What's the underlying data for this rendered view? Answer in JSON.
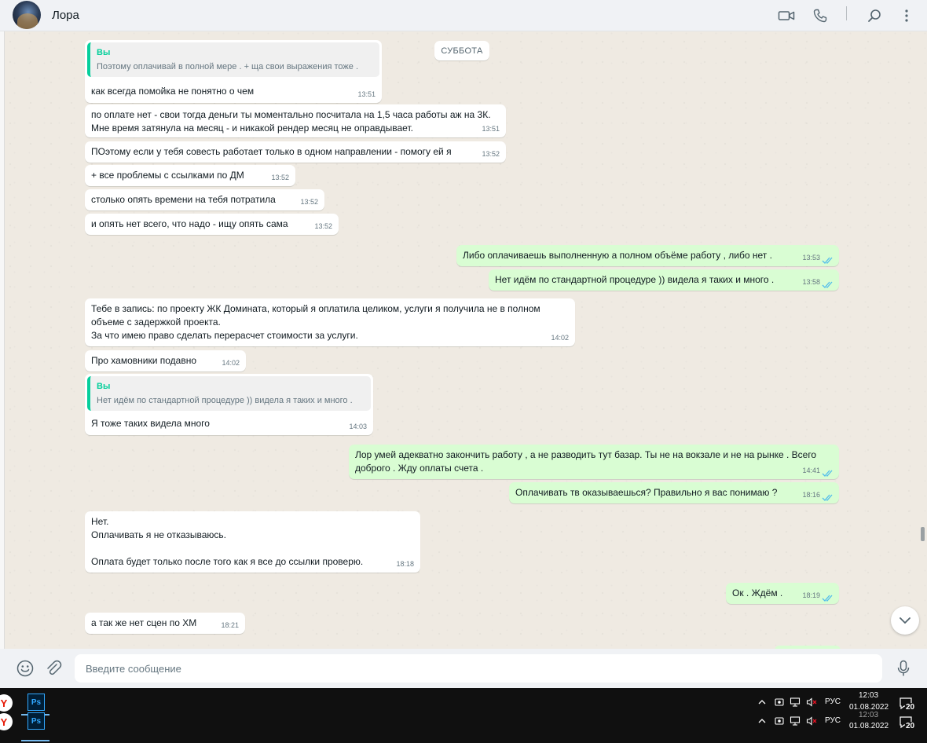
{
  "header": {
    "contact_name": "Лора",
    "icons": [
      "video-call-icon",
      "voice-call-icon",
      "search-icon",
      "menu-icon"
    ]
  },
  "chat": {
    "date_chip": "СУББОТА",
    "messages": [
      {
        "dir": "in",
        "quote_author": "Вы",
        "quote_text": "Поэтому оплачивай в полной мере . + ща свои выражения тоже .",
        "text": "как всегда помойка не понятно о чем",
        "time": "13:51"
      },
      {
        "dir": "in",
        "text": "по оплате нет - свои тогда деньги ты моментально посчитала на 1,5 часа работы аж на 3К.\nМне время затянула на месяц - и никакой рендер месяц не оправдывает.",
        "time": "13:51"
      },
      {
        "dir": "in",
        "text": "ПОэтому если у тебя совесть работает только в одном направлении - помогу ей я",
        "time": "13:52"
      },
      {
        "dir": "in",
        "text": "+ все проблемы с ссылками по ДМ",
        "time": "13:52"
      },
      {
        "dir": "in",
        "text": "столько опять времени на тебя потратила",
        "time": "13:52"
      },
      {
        "dir": "in",
        "text": "и опять нет всего, что надо - ищу опять сама",
        "time": "13:52"
      },
      {
        "dir": "out",
        "text": "Либо оплачиваешь выполненную а полном объёме работу , либо нет .",
        "time": "13:53"
      },
      {
        "dir": "out",
        "text": "Нет идём по стандартной процедуре )) видела я таких и много .",
        "time": "13:58"
      },
      {
        "dir": "in",
        "text": "Тебе в запись: по проекту ЖК Домината, который я оплатила целиком, услуги я получила не в полном объеме с задержкой проекта.\nЗа что имею право сделать перерасчет стоимости за услуги.",
        "time": "14:02"
      },
      {
        "dir": "in",
        "text": "Про хамовники подавно",
        "time": "14:02"
      },
      {
        "dir": "in",
        "quote_author": "Вы",
        "quote_text": "Нет идём по стандартной процедуре )) видела я таких и много .",
        "text": "Я тоже таких видела много",
        "time": "14:03"
      },
      {
        "dir": "out",
        "text": "Лор умей адекватно закончить работу , а не разводить тут базар. Ты не на вокзале и не на рынке . Всего доброго . Жду оплаты счета .",
        "time": "14:41"
      },
      {
        "dir": "out",
        "text": "Оплачивать тв оказываешься? Правильно я вас понимаю ?",
        "time": "18:16"
      },
      {
        "dir": "in",
        "text": "Нет.\nОплачивать я не отказываюсь.\n\nОплата будет только после того как я все до ссылки проверю.",
        "time": "18:18"
      },
      {
        "dir": "out",
        "text": "Ок . Ждём .",
        "time": "18:19"
      },
      {
        "dir": "in",
        "text": "а так же нет сцен по ХМ",
        "time": "18:21"
      }
    ]
  },
  "composer": {
    "placeholder": "Введите сообщение",
    "icons": [
      "emoji-icon",
      "attach-icon",
      "microphone-icon"
    ]
  },
  "taskbar": {
    "apps": [
      {
        "icon": "yandex-browser-icon",
        "label": "Y"
      },
      {
        "icon": "photoshop-icon",
        "label": "Ps"
      },
      {
        "icon": "yandex-browser-icon",
        "label": "Y"
      },
      {
        "icon": "photoshop-icon",
        "label": "Ps"
      }
    ],
    "tray_rows": [
      {
        "lang": "РУС",
        "time": "12:03",
        "date": "01.08.2022",
        "notifications": "20"
      },
      {
        "lang": "РУС",
        "time": "12:03",
        "date": "01.08.2022",
        "notifications": "20"
      }
    ],
    "colors": {
      "accent": "#06cf9c",
      "outgoing": "#d9fdd3",
      "tick": "#53bdeb"
    }
  }
}
